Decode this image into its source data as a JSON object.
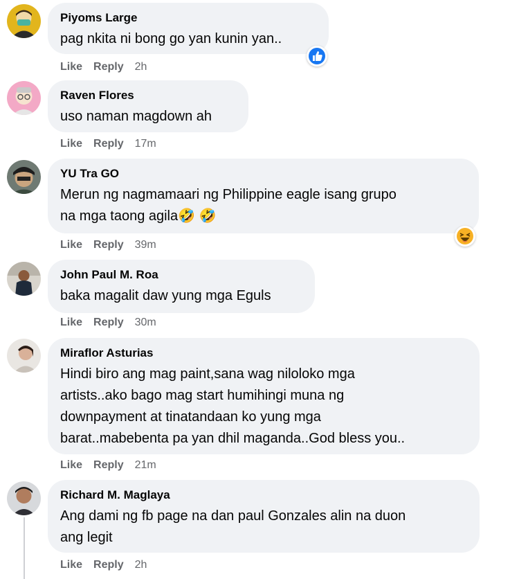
{
  "comments": [
    {
      "author": "Piyoms Large",
      "text": "pag nkita ni bong go yan kunin yan..",
      "actions": {
        "like": "Like",
        "reply": "Reply",
        "time": "2h"
      },
      "reaction": "like-reaction-icon"
    },
    {
      "author": "Raven Flores",
      "text": "uso naman magdown ah",
      "actions": {
        "like": "Like",
        "reply": "Reply",
        "time": "17m"
      }
    },
    {
      "author": "YU Tra GO",
      "text_line1": "Merun ng nagmamaari ng Philippine eagle isang grupo",
      "text_line2": "na mga taong agila",
      "text_emoji": "🤣 🤣",
      "actions": {
        "like": "Like",
        "reply": "Reply",
        "time": "39m"
      },
      "reaction": "haha-reaction-icon"
    },
    {
      "author": "John Paul M. Roa",
      "text": "baka magalit daw yung mga Eguls",
      "actions": {
        "like": "Like",
        "reply": "Reply",
        "time": "30m"
      }
    },
    {
      "author": "Miraflor Asturias",
      "text_lines": [
        "Hindi biro ang mag paint,sana wag niloloko mga",
        "artists..ako bago mag start humihingi muna ng",
        "downpayment at tinatandaan ko yung mga",
        "barat..mabebenta pa yan dhil maganda..God bless you.."
      ],
      "actions": {
        "like": "Like",
        "reply": "Reply",
        "time": "21m"
      }
    },
    {
      "author": "Richard M. Maglaya",
      "text_lines": [
        "Ang dami ng fb page na dan paul Gonzales alin na duon",
        "ang legit"
      ],
      "actions": {
        "like": "Like",
        "reply": "Reply",
        "time": "2h"
      }
    }
  ],
  "colors": {
    "bubble": "#f0f2f5",
    "meta": "#65676b",
    "like_blue": "#1877f2",
    "haha_yellow": "#f7b125"
  }
}
